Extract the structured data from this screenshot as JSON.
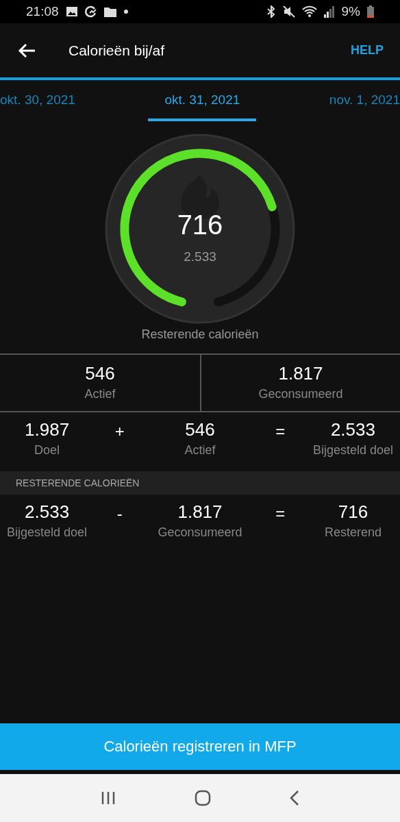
{
  "status_bar": {
    "time": "21:08",
    "battery": "9%"
  },
  "app_bar": {
    "title": "Calorieën bij/af",
    "action": "HELP"
  },
  "date_tabs": [
    {
      "label": "okt. 30, 2021",
      "selected": false
    },
    {
      "label": "okt. 31, 2021",
      "selected": true
    },
    {
      "label": "nov. 1, 2021",
      "selected": false
    }
  ],
  "gauge": {
    "value": "716",
    "total": "2.533",
    "label": "Resterende calorieën"
  },
  "summary": [
    {
      "value": "546",
      "label": "Actief"
    },
    {
      "value": "1.817",
      "label": "Geconsumeerd"
    }
  ],
  "goal_equation": [
    {
      "kind": "term",
      "value": "1.987",
      "label": "Doel"
    },
    {
      "kind": "operator",
      "symbol": "+"
    },
    {
      "kind": "term",
      "value": "546",
      "label": "Actief"
    },
    {
      "kind": "operator",
      "symbol": "="
    },
    {
      "kind": "term",
      "value": "2.533",
      "label": "Bijgesteld doel"
    }
  ],
  "remaining_section": {
    "header": "RESTERENDE CALORIEËN",
    "equation": [
      {
        "kind": "term",
        "value": "2.533",
        "label": "Bijgesteld doel"
      },
      {
        "kind": "operator",
        "symbol": "-"
      },
      {
        "kind": "term",
        "value": "1.817",
        "label": "Geconsumeerd"
      },
      {
        "kind": "operator",
        "symbol": "="
      },
      {
        "kind": "term",
        "value": "716",
        "label": "Resterend"
      }
    ]
  },
  "register_button": "Calorieën registreren in MFP"
}
